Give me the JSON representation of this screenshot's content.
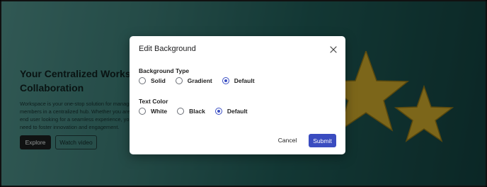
{
  "hero": {
    "title": "Your Centralized Workspace Collaboration",
    "description": "Workspace is your one-stop solution for managing members in a centralized hub. Whether you are an end user looking for a seamless experience, you need to foster innovation and engagement.",
    "explore_label": "Explore",
    "watch_label": "Watch video"
  },
  "modal": {
    "title": "Edit Background",
    "close_icon": "close-icon",
    "background_type": {
      "label": "Background Type",
      "options": [
        {
          "label": "Solid",
          "checked": false
        },
        {
          "label": "Gradient",
          "checked": false
        },
        {
          "label": "Default",
          "checked": true
        }
      ]
    },
    "text_color": {
      "label": "Text Color",
      "options": [
        {
          "label": "White",
          "checked": false
        },
        {
          "label": "Black",
          "checked": false
        },
        {
          "label": "Default",
          "checked": true
        }
      ]
    },
    "cancel_label": "Cancel",
    "submit_label": "Submit"
  },
  "colors": {
    "accent": "#3a4cc0",
    "star": "#c9a52a"
  }
}
